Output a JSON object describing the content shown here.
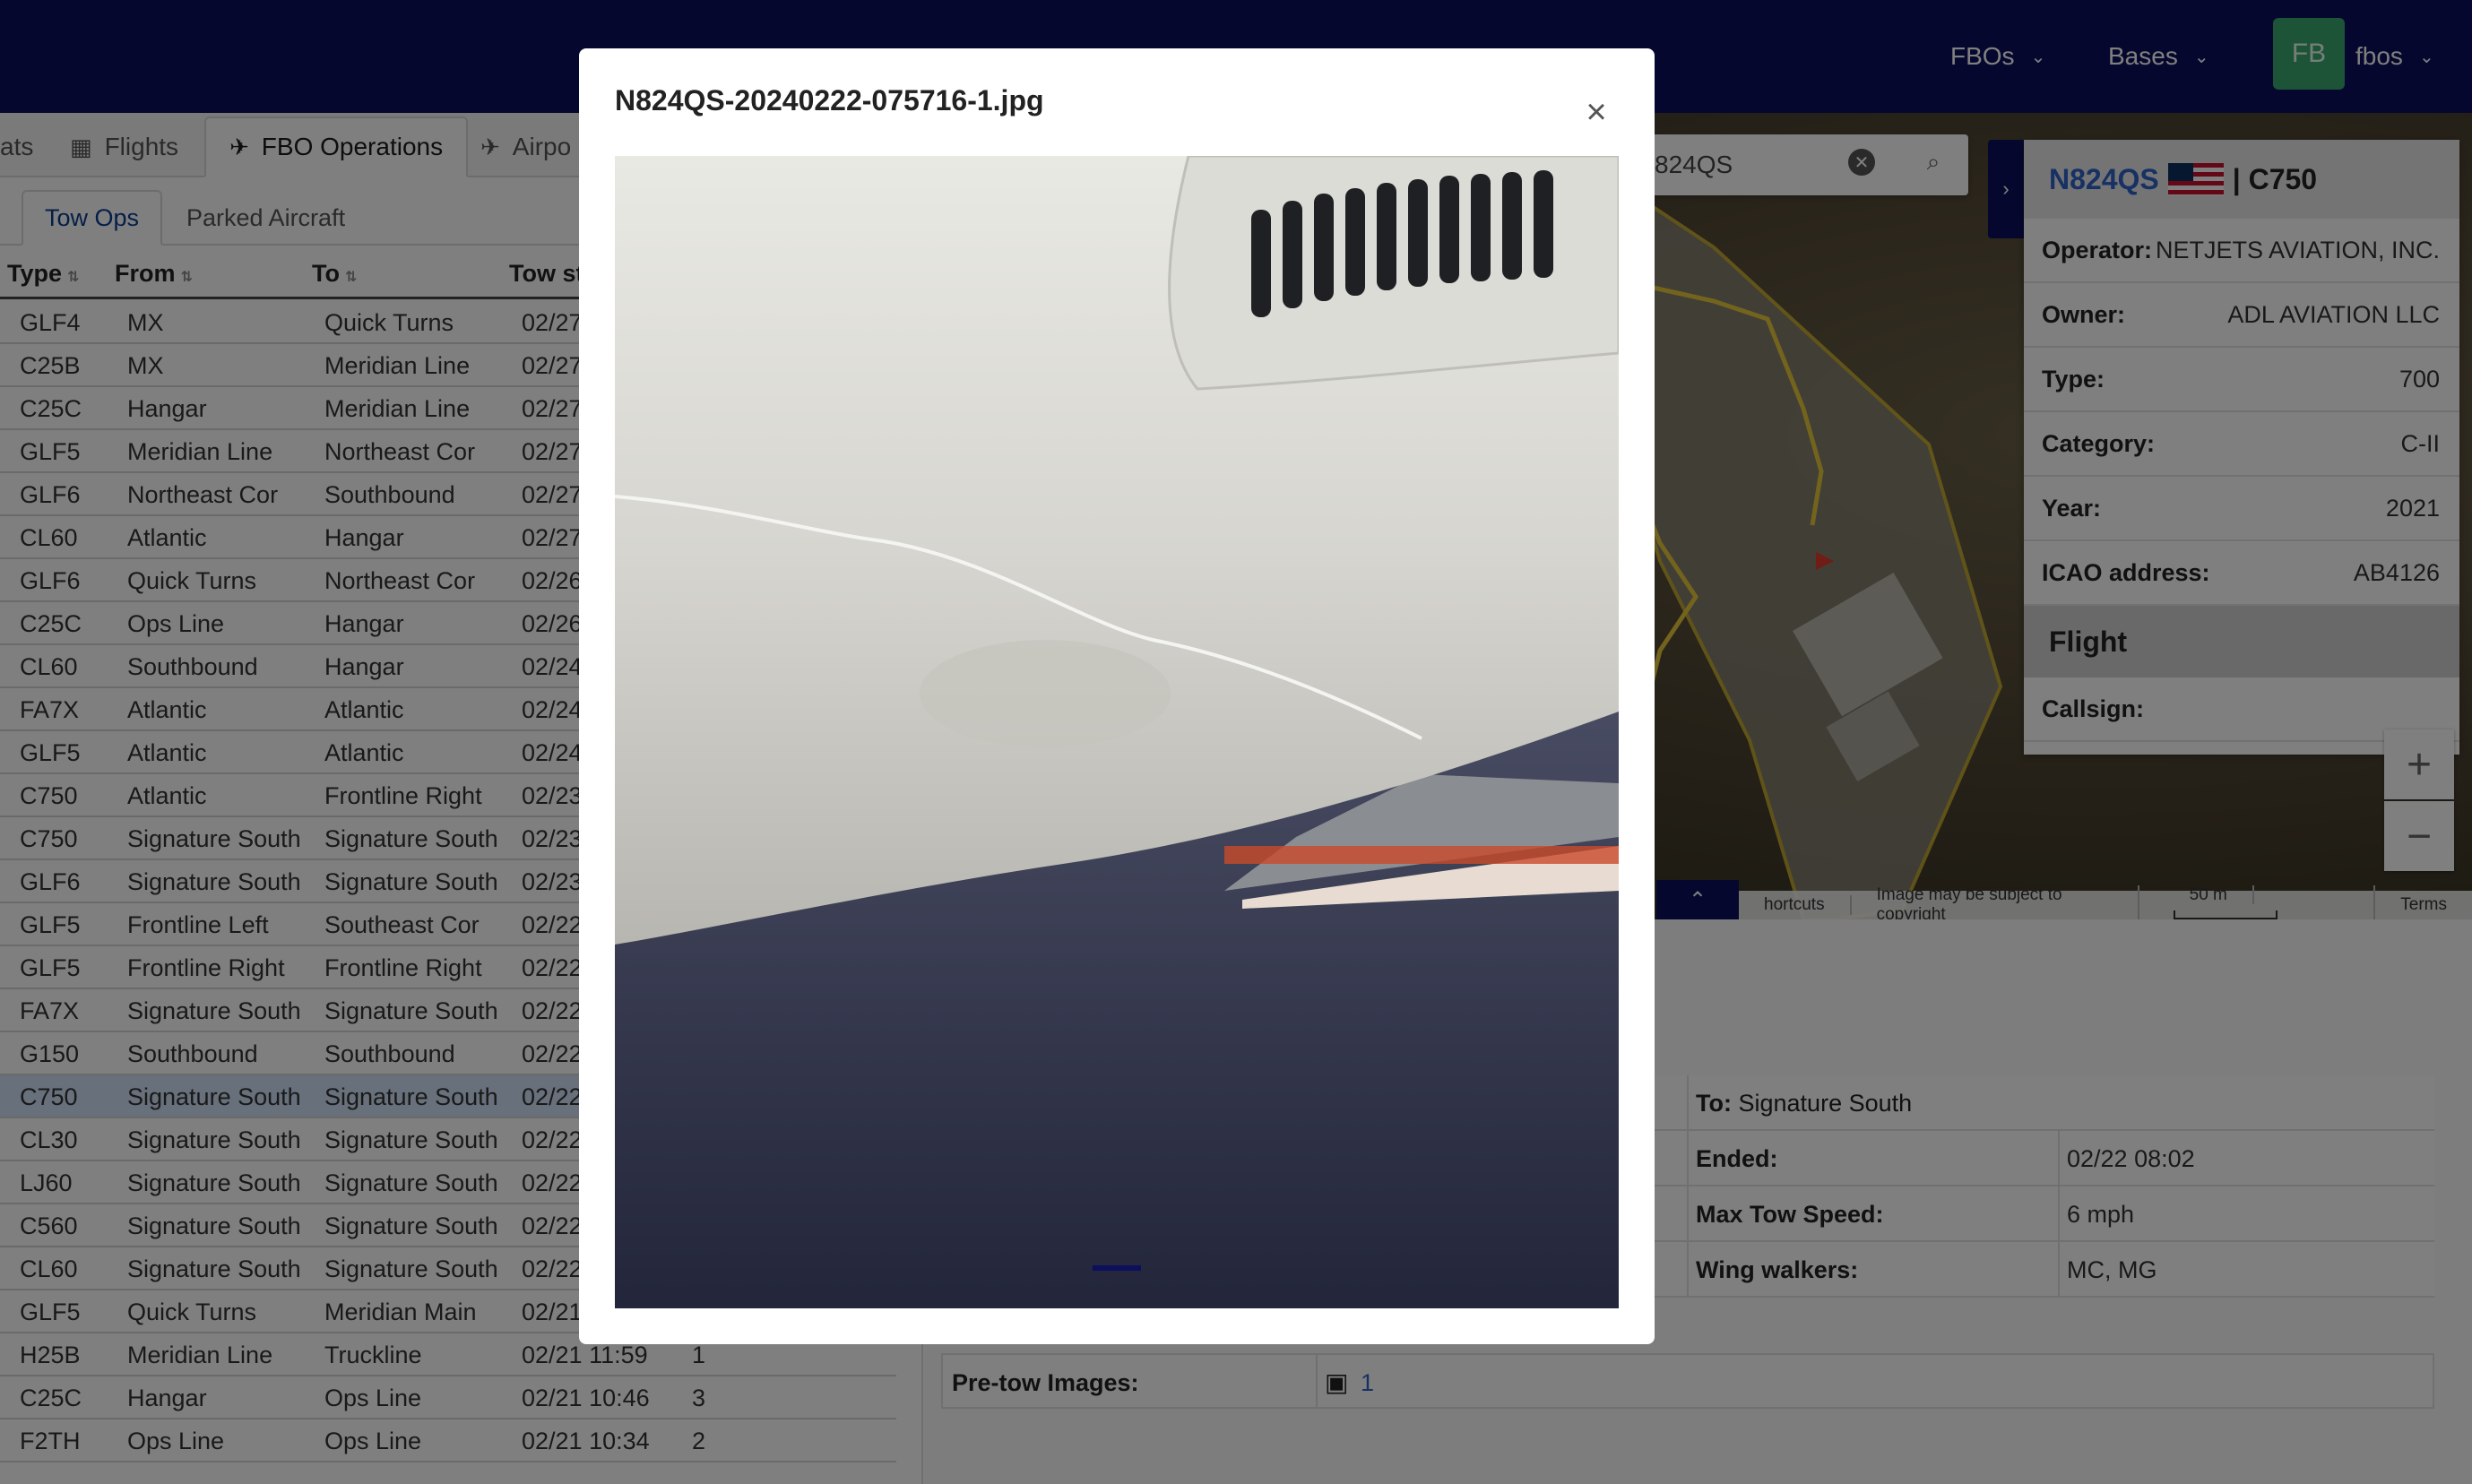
{
  "nav": {
    "fbos_label": "FBOs",
    "bases_label": "Bases",
    "avatar_initials": "FB",
    "user_label": "fbos"
  },
  "main_tabs": [
    {
      "label": "ats",
      "icon": "truncated"
    },
    {
      "label": "Flights",
      "icon": "calendar-icon"
    },
    {
      "label": "FBO Operations",
      "icon": "plane-icon"
    },
    {
      "label": "Airpo",
      "icon": "departure-icon"
    }
  ],
  "sub_tabs": [
    "Tow Ops",
    "Parked Aircraft"
  ],
  "table": {
    "headers": {
      "type": "Type",
      "from": "From",
      "to": "To",
      "start": "Tow st"
    },
    "rows": [
      {
        "type": "GLF4",
        "from": "MX",
        "to": "Quick Turns",
        "start": "02/27",
        "num": ""
      },
      {
        "type": "C25B",
        "from": "MX",
        "to": "Meridian Line",
        "start": "02/27",
        "num": ""
      },
      {
        "type": "C25C",
        "from": "Hangar",
        "to": "Meridian Line",
        "start": "02/27",
        "num": ""
      },
      {
        "type": "GLF5",
        "from": "Meridian Line",
        "to": "Northeast Cor",
        "start": "02/27",
        "num": ""
      },
      {
        "type": "GLF6",
        "from": "Northeast Cor",
        "to": "Southbound",
        "start": "02/27",
        "num": ""
      },
      {
        "type": "CL60",
        "from": "Atlantic",
        "to": "Hangar",
        "start": "02/27",
        "num": ""
      },
      {
        "type": "GLF6",
        "from": "Quick Turns",
        "to": "Northeast Cor",
        "start": "02/26",
        "num": ""
      },
      {
        "type": "C25C",
        "from": "Ops Line",
        "to": "Hangar",
        "start": "02/26",
        "num": ""
      },
      {
        "type": "CL60",
        "from": "Southbound",
        "to": "Hangar",
        "start": "02/24",
        "num": ""
      },
      {
        "type": "FA7X",
        "from": "Atlantic",
        "to": "Atlantic",
        "start": "02/24",
        "num": ""
      },
      {
        "type": "GLF5",
        "from": "Atlantic",
        "to": "Atlantic",
        "start": "02/24",
        "num": ""
      },
      {
        "type": "C750",
        "from": "Atlantic",
        "to": "Frontline Right",
        "start": "02/23",
        "num": ""
      },
      {
        "type": "C750",
        "from": "Signature South",
        "to": "Signature South",
        "start": "02/23",
        "num": ""
      },
      {
        "type": "GLF6",
        "from": "Signature South",
        "to": "Signature South",
        "start": "02/23",
        "num": ""
      },
      {
        "type": "GLF5",
        "from": "Frontline Left",
        "to": "Southeast Cor",
        "start": "02/22",
        "num": ""
      },
      {
        "type": "GLF5",
        "from": "Frontline Right",
        "to": "Frontline Right",
        "start": "02/22",
        "num": ""
      },
      {
        "type": "FA7X",
        "from": "Signature South",
        "to": "Signature South",
        "start": "02/22",
        "num": ""
      },
      {
        "type": "G150",
        "from": "Southbound",
        "to": "Southbound",
        "start": "02/22",
        "num": ""
      },
      {
        "type": "C750",
        "from": "Signature South",
        "to": "Signature South",
        "start": "02/22",
        "num": "",
        "selected": true
      },
      {
        "type": "CL30",
        "from": "Signature South",
        "to": "Signature South",
        "start": "02/22",
        "num": ""
      },
      {
        "type": "LJ60",
        "from": "Signature South",
        "to": "Signature South",
        "start": "02/22",
        "num": ""
      },
      {
        "type": "C560",
        "from": "Signature South",
        "to": "Signature South",
        "start": "02/22",
        "num": ""
      },
      {
        "type": "CL60",
        "from": "Signature South",
        "to": "Signature South",
        "start": "02/22",
        "num": ""
      },
      {
        "type": "GLF5",
        "from": "Quick Turns",
        "to": "Meridian Main",
        "start": "02/21",
        "num": ""
      },
      {
        "type": "H25B",
        "from": "Meridian Line",
        "to": "Truckline",
        "start": "02/21 11:59",
        "num": "1"
      },
      {
        "type": "C25C",
        "from": "Hangar",
        "to": "Ops Line",
        "start": "02/21 10:46",
        "num": "3"
      },
      {
        "type": "F2TH",
        "from": "Ops Line",
        "to": "Ops Line",
        "start": "02/21 10:34",
        "num": "2"
      }
    ]
  },
  "map": {
    "search_value": "824QS",
    "attribution": {
      "shortcuts": "hortcuts",
      "copyright": "Image may be subject to copyright",
      "scale": "50 m",
      "terms": "Terms"
    },
    "zoom_in": "+",
    "zoom_out": "−"
  },
  "aircraft": {
    "registration": "N824QS",
    "type_code": "| C750",
    "rows": [
      {
        "label": "Operator:",
        "value": "NETJETS AVIATION, INC."
      },
      {
        "label": "Owner:",
        "value": "ADL AVIATION LLC"
      },
      {
        "label": "Type:",
        "value": "700"
      },
      {
        "label": "Category:",
        "value": "C-II"
      },
      {
        "label": "Year:",
        "value": "2021"
      },
      {
        "label": "ICAO address:",
        "value": "AB4126"
      }
    ],
    "flight_section": "Flight",
    "callsign_label": "Callsign:",
    "callsign_value": ""
  },
  "details": {
    "to_label": "To:",
    "to_value": "Signature South",
    "ended_label": "Ended:",
    "ended_value": "02/22 08:02",
    "max_speed_label": "Max Tow Speed:",
    "max_speed_value": "6 mph",
    "wing_label": "Wing walkers:",
    "wing_value": "MC, MG",
    "pretow_label": "Pre-tow Images:",
    "pretow_count": "1"
  },
  "modal": {
    "title": "N824QS-20240222-075716-1.jpg",
    "close": "×"
  },
  "colors": {
    "navbar": "#0b0f5c",
    "avatar": "#3aa76d",
    "link": "#2e62c8",
    "selected_row": "#cfe0f7"
  }
}
